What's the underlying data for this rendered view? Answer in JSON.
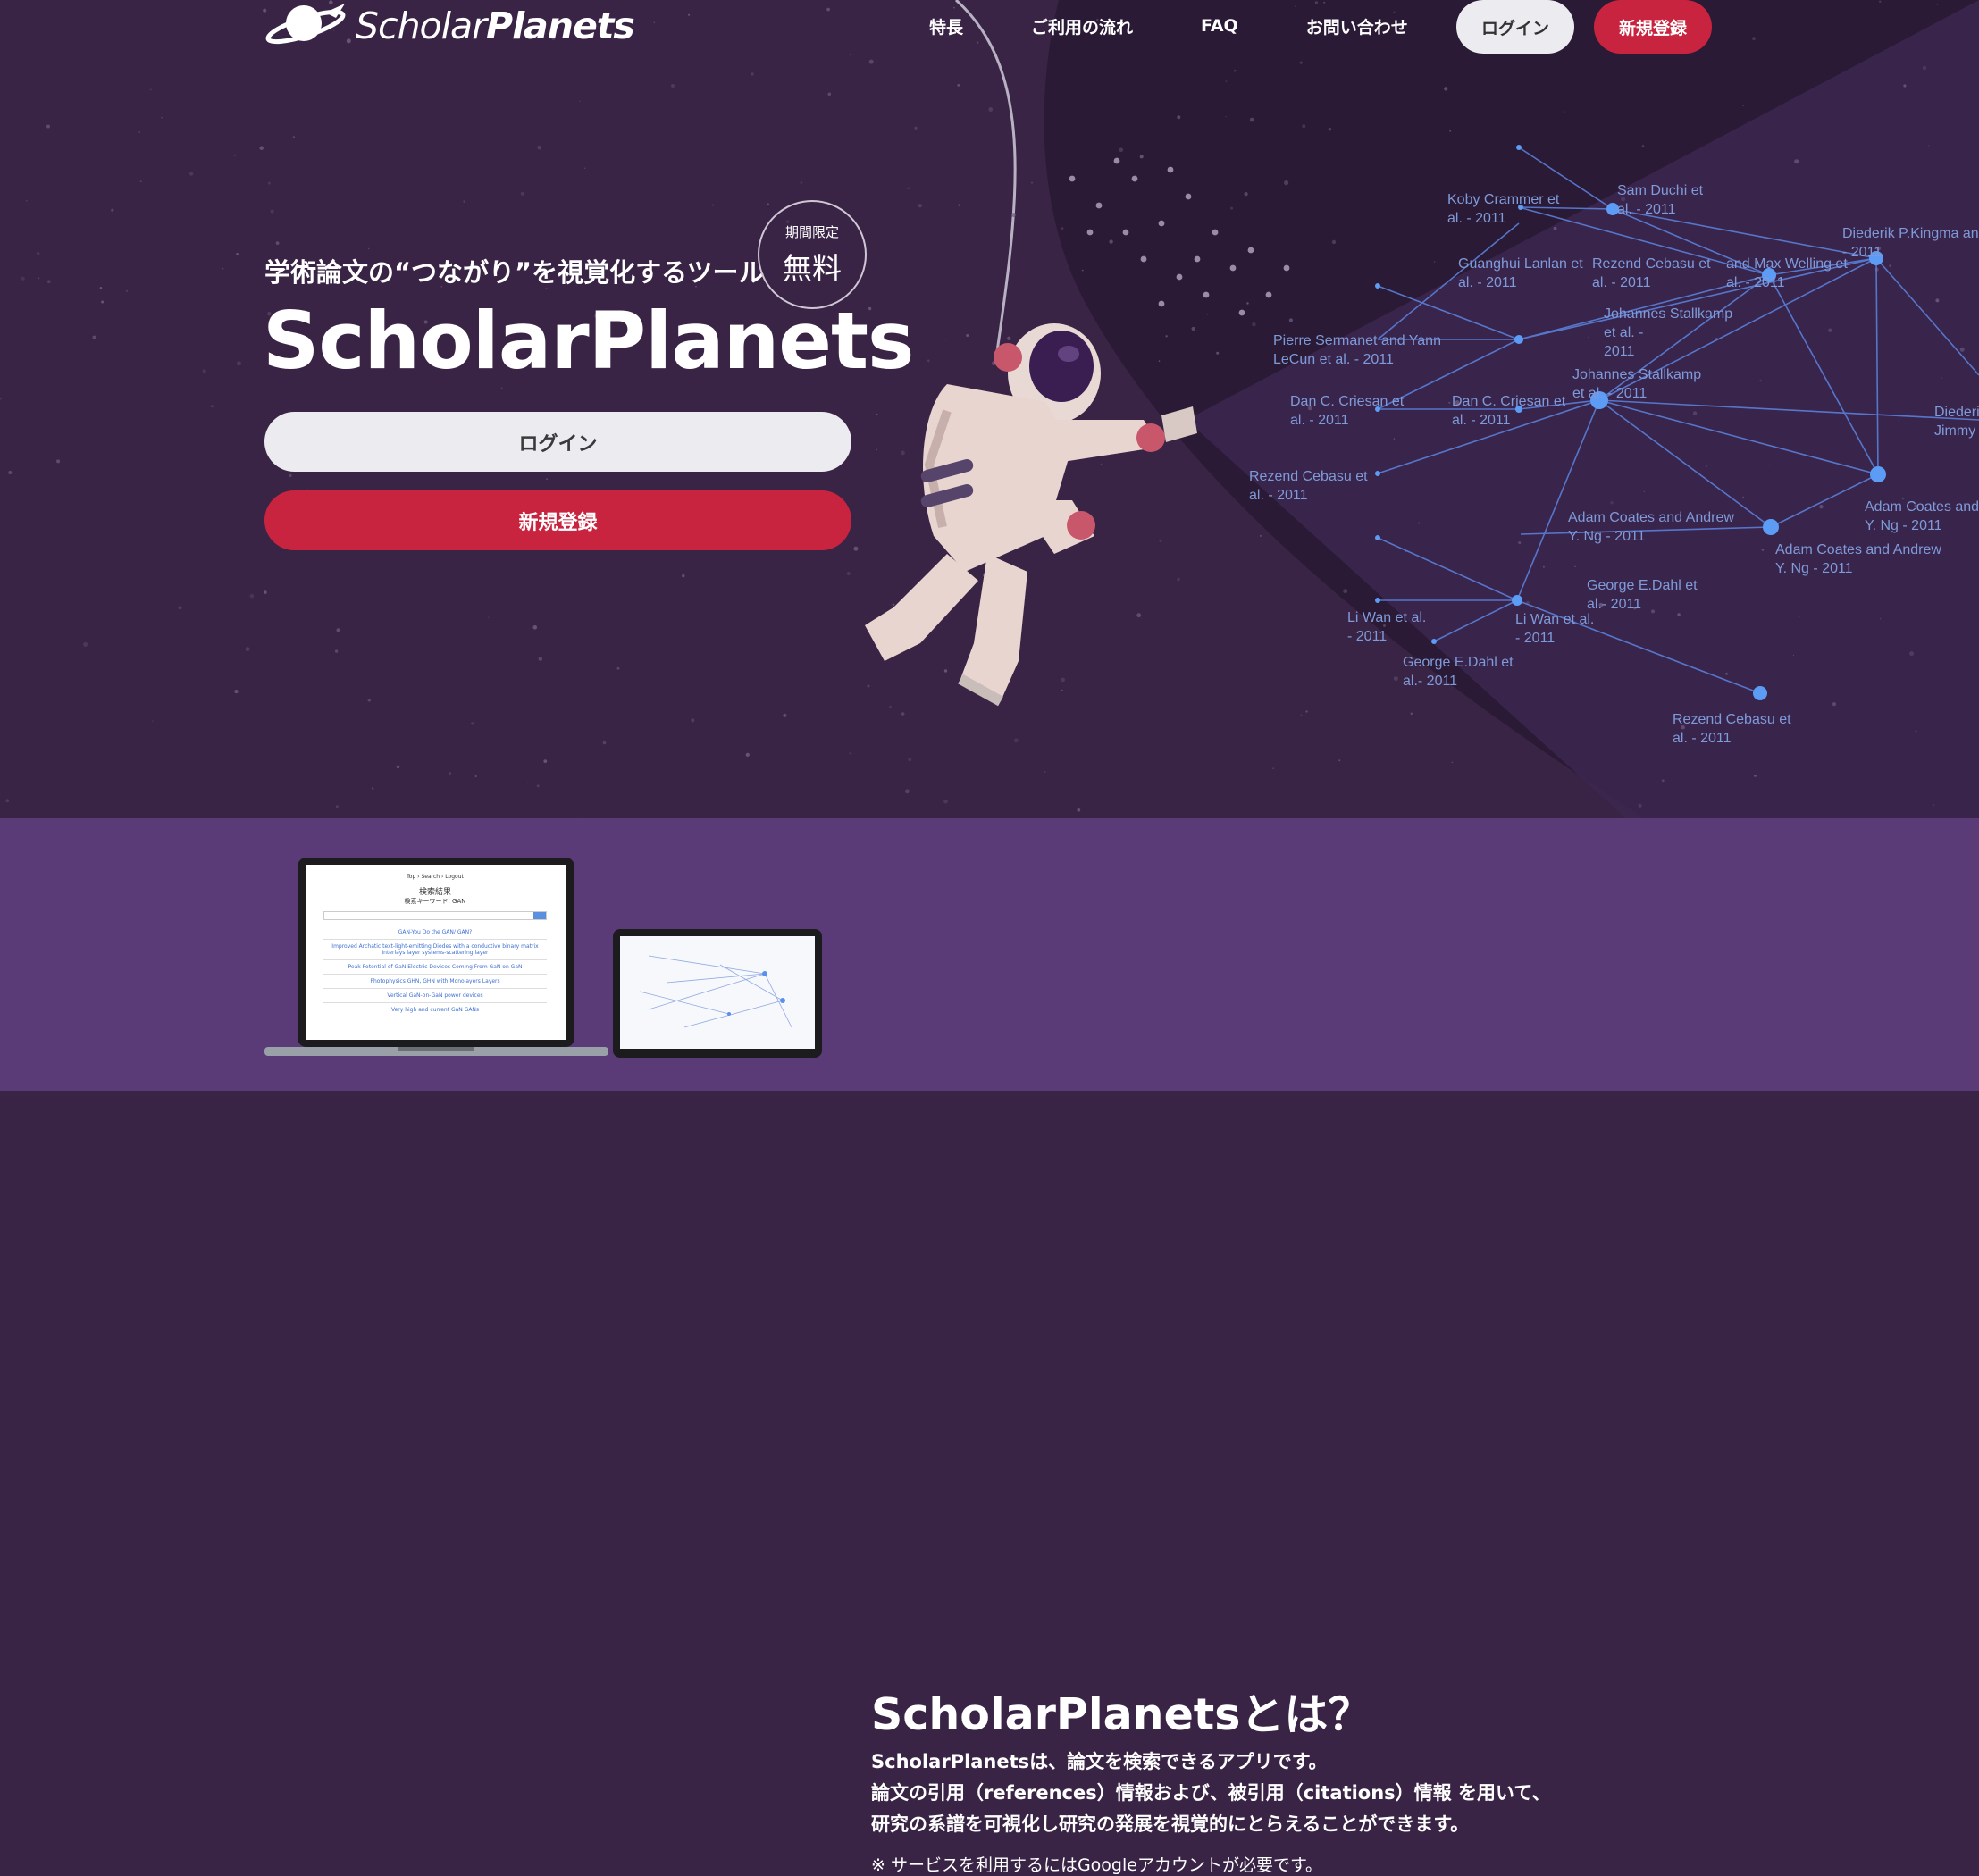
{
  "brand": {
    "name_light": "Scholar",
    "name_bold": "Planets"
  },
  "nav": {
    "items": [
      "特長",
      "ご利用の流れ",
      "FAQ",
      "お問い合わせ"
    ],
    "login": "ログイン",
    "signup": "新規登録"
  },
  "hero": {
    "tagline": "学術論文の“つながり”を視覚化するツール",
    "badge_top": "期間限定",
    "badge_main": "無料",
    "title": "ScholarPlanets",
    "login": "ログイン",
    "signup": "新規登録"
  },
  "graph": {
    "labels": [
      [
        "Koby Crammer et",
        "al. - 2011"
      ],
      [
        "Sam Duchi et",
        "al. - 2011"
      ],
      [
        "Diederik P.Kingma and",
        "- 2011"
      ],
      [
        "Guanghui Lanlan et",
        "al. - 2011"
      ],
      [
        "Rezend Cebasu et",
        "al. - 2011"
      ],
      [
        "and Max Welling et",
        "al. - 2011"
      ],
      [
        "Johannes Stallkamp",
        "et al. -",
        "2011"
      ],
      [
        "Pierre Sermanet and Yann",
        "LeCun et al. - 2011"
      ],
      [
        "Johannes Stallkamp",
        "et al. - 2011"
      ],
      [
        "Dan C. Criesan et",
        "al. - 2011"
      ],
      [
        "Dan C. Criesan et",
        "al. - 2011"
      ],
      [
        "Diederik",
        "Jimmy"
      ],
      [
        "Rezend Cebasu et",
        "al. - 2011"
      ],
      [
        "Adam Coates and",
        "Y. Ng - 2011"
      ],
      [
        "Adam Coates and Andrew",
        "Y. Ng - 2011"
      ],
      [
        "Adam Coates and Andrew",
        "Y. Ng - 2011"
      ],
      [
        "George E.Dahl et",
        "al.- 2011"
      ],
      [
        "Li Wan et al.",
        "- 2011"
      ],
      [
        "Li Wan et al.",
        "- 2011"
      ],
      [
        "George E.Dahl et",
        "al.- 2011"
      ],
      [
        "Rezend Cebasu et",
        "al. - 2011"
      ]
    ]
  },
  "about": {
    "title": "ScholarPlanetsとは？",
    "lines": [
      "ScholarPlanetsは、論文を検索できるアプリです。",
      "論文の引用（references）情報および、被引用（citations）情報 を用いて、",
      "研究の系譜を可視化し研究の発展を視覚的にとらえることができます。"
    ],
    "note": "※ サービスを利用するにはGoogleアカウントが必要です。",
    "mock": {
      "breadcrumb": "Top › Search › Logout",
      "heading": "検索結果",
      "sub": "検索キーワード: GAN",
      "results": [
        "GAN-You Do the GAN/ GAN?",
        "Improved Archatic text-light-emitting Diodes with a conductive binary matrix interlays layer systems-scattering layer",
        "Peak Potential of GaN Electric Devices Coming From GaN on GaN",
        "Photophysics GHN, GHN with Monolayers Layers",
        "Vertical GaN-on-GaN power devices",
        "Very high and current GaN GANs"
      ]
    },
    "colors": {
      "accent": "#c8243f",
      "hero_bg": "#3a2446",
      "section_bg": "#5b3a78",
      "graph": "#5c8ef0"
    }
  }
}
